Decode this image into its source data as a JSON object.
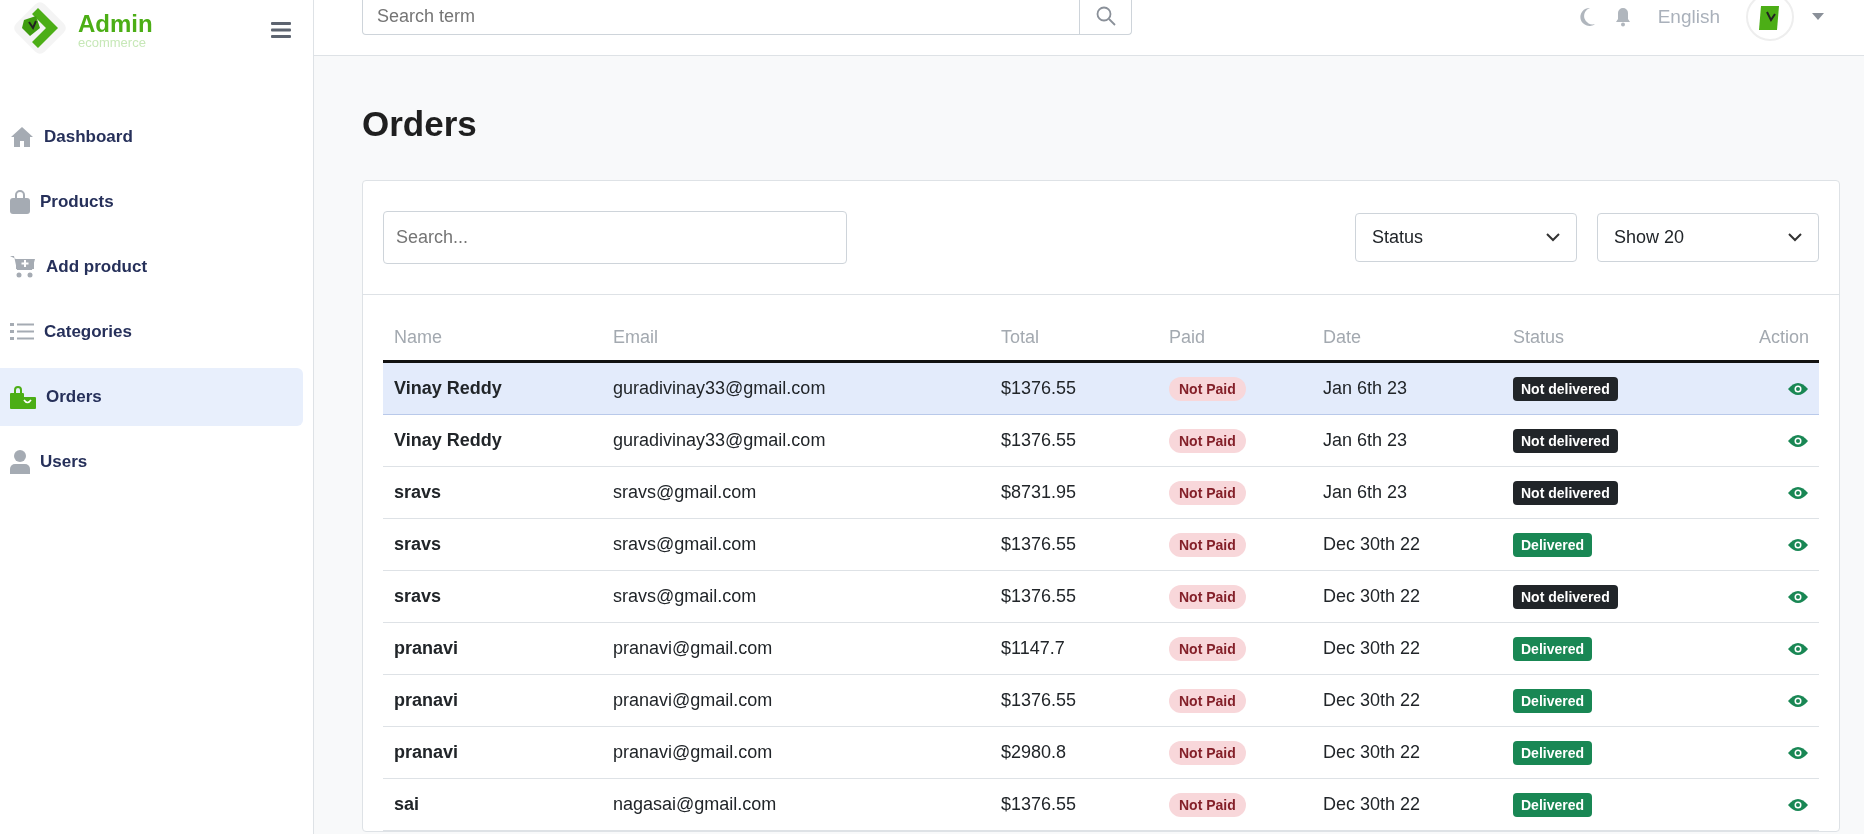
{
  "brand": {
    "title": "Admin",
    "subtitle": "ecommerce"
  },
  "sidebar": {
    "items": [
      {
        "label": "Dashboard",
        "kind": "home",
        "selected": false
      },
      {
        "label": "Products",
        "kind": "bag",
        "selected": false
      },
      {
        "label": "Add product",
        "kind": "cart",
        "selected": false
      },
      {
        "label": "Categories",
        "kind": "list",
        "selected": false
      },
      {
        "label": "Orders",
        "kind": "orders",
        "selected": true
      },
      {
        "label": "Users",
        "kind": "user",
        "selected": false
      }
    ]
  },
  "topbar": {
    "search": {
      "placeholder": "Search term"
    },
    "language": "English"
  },
  "page": {
    "title": "Orders"
  },
  "filters": {
    "search": {
      "placeholder": "Search..."
    },
    "status": "Status",
    "show": "Show 20"
  },
  "table": {
    "columns": [
      "Name",
      "Email",
      "Total",
      "Paid",
      "Date",
      "Status",
      "Action"
    ],
    "rows": [
      {
        "name": "Vinay Reddy",
        "email": "guradivinay33@gmail.com",
        "total": "$1376.55",
        "paid_label": "Not Paid",
        "paid": false,
        "date": "Jan 6th 23",
        "status": "Not delivered",
        "delivered": false,
        "selected": true
      },
      {
        "name": "Vinay Reddy",
        "email": "guradivinay33@gmail.com",
        "total": "$1376.55",
        "paid_label": "Not Paid",
        "paid": false,
        "date": "Jan 6th 23",
        "status": "Not delivered",
        "delivered": false,
        "selected": false
      },
      {
        "name": "sravs",
        "email": "sravs@gmail.com",
        "total": "$8731.95",
        "paid_label": "Not Paid",
        "paid": false,
        "date": "Jan 6th 23",
        "status": "Not delivered",
        "delivered": false,
        "selected": false
      },
      {
        "name": "sravs",
        "email": "sravs@gmail.com",
        "total": "$1376.55",
        "paid_label": "Not Paid",
        "paid": false,
        "date": "Dec 30th 22",
        "status": "Delivered",
        "delivered": true,
        "selected": false
      },
      {
        "name": "sravs",
        "email": "sravs@gmail.com",
        "total": "$1376.55",
        "paid_label": "Not Paid",
        "paid": false,
        "date": "Dec 30th 22",
        "status": "Not delivered",
        "delivered": false,
        "selected": false
      },
      {
        "name": "pranavi",
        "email": "pranavi@gmail.com",
        "total": "$1147.7",
        "paid_label": "Not Paid",
        "paid": false,
        "date": "Dec 30th 22",
        "status": "Delivered",
        "delivered": true,
        "selected": false
      },
      {
        "name": "pranavi",
        "email": "pranavi@gmail.com",
        "total": "$1376.55",
        "paid_label": "Not Paid",
        "paid": false,
        "date": "Dec 30th 22",
        "status": "Delivered",
        "delivered": true,
        "selected": false
      },
      {
        "name": "pranavi",
        "email": "pranavi@gmail.com",
        "total": "$2980.8",
        "paid_label": "Not Paid",
        "paid": false,
        "date": "Dec 30th 22",
        "status": "Delivered",
        "delivered": true,
        "selected": false
      },
      {
        "name": "sai",
        "email": "nagasai@gmail.com",
        "total": "$1376.55",
        "paid_label": "Not Paid",
        "paid": false,
        "date": "Dec 30th 22",
        "status": "Delivered",
        "delivered": true,
        "selected": false
      }
    ]
  }
}
